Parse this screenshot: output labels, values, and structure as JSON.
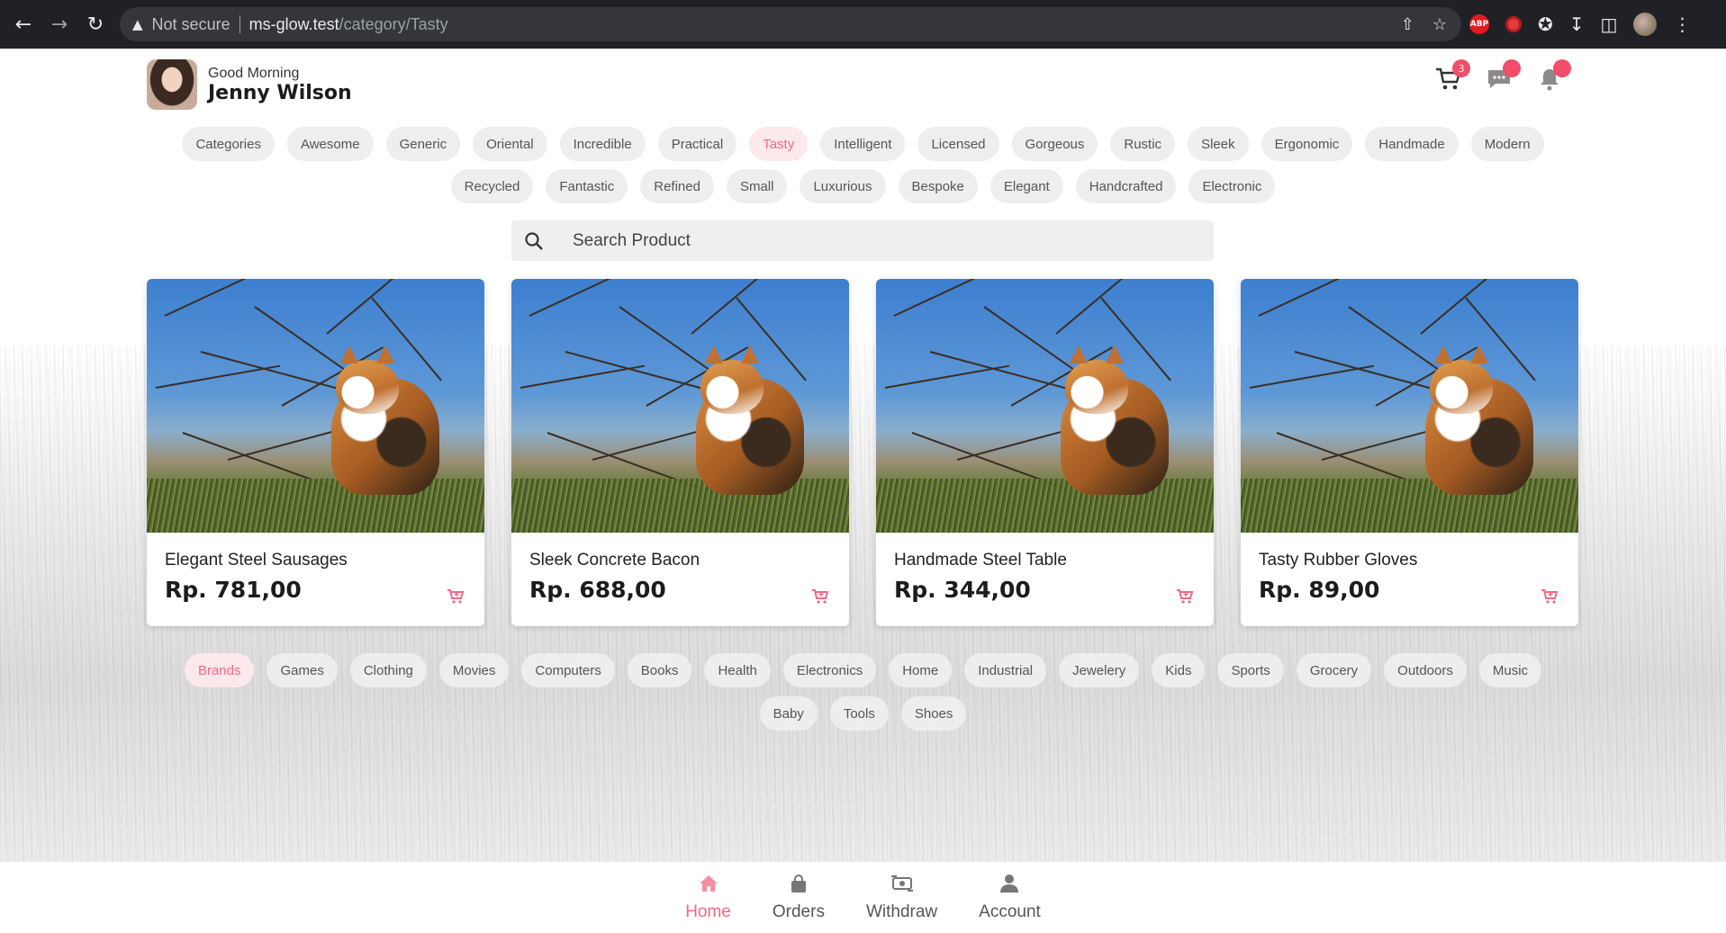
{
  "browser": {
    "not_secure": "Not secure",
    "url_host": "ms-glow.test",
    "url_path": "/category/Tasty",
    "abp_label": "ABP"
  },
  "header": {
    "greeting": "Good Morning",
    "user_name": "Jenny Wilson",
    "cart_count": "3"
  },
  "categories_row1": [
    "Categories",
    "Awesome",
    "Generic",
    "Oriental",
    "Incredible",
    "Practical",
    "Tasty",
    "Intelligent",
    "Licensed",
    "Gorgeous",
    "Rustic",
    "Sleek",
    "Ergonomic",
    "Handmade",
    "Modern"
  ],
  "categories_row2": [
    "Recycled",
    "Fantastic",
    "Refined",
    "Small",
    "Luxurious",
    "Bespoke",
    "Elegant",
    "Handcrafted",
    "Electronic"
  ],
  "active_category": "Tasty",
  "search": {
    "placeholder": "Search Product"
  },
  "products": [
    {
      "name": "Elegant Steel Sausages",
      "price": "Rp. 781,00"
    },
    {
      "name": "Sleek Concrete Bacon",
      "price": "Rp. 688,00"
    },
    {
      "name": "Handmade Steel Table",
      "price": "Rp. 344,00"
    },
    {
      "name": "Tasty Rubber Gloves",
      "price": "Rp. 89,00"
    }
  ],
  "brands_row1": [
    "Brands",
    "Games",
    "Clothing",
    "Movies",
    "Computers",
    "Books",
    "Health",
    "Electronics",
    "Home",
    "Industrial",
    "Jewelery",
    "Kids",
    "Sports",
    "Grocery",
    "Outdoors",
    "Music"
  ],
  "brands_row2": [
    "Baby",
    "Tools",
    "Shoes"
  ],
  "active_brand": "Brands",
  "bottom_nav": [
    {
      "label": "Home",
      "icon": "home-icon",
      "active": true
    },
    {
      "label": "Orders",
      "icon": "lock-bag-icon",
      "active": false
    },
    {
      "label": "Withdraw",
      "icon": "withdraw-icon",
      "active": false
    },
    {
      "label": "Account",
      "icon": "user-icon",
      "active": false
    }
  ],
  "colors": {
    "accent": "#f06a85",
    "chip_bg": "#eeeeee",
    "chip_active_bg": "#fde8ec"
  }
}
